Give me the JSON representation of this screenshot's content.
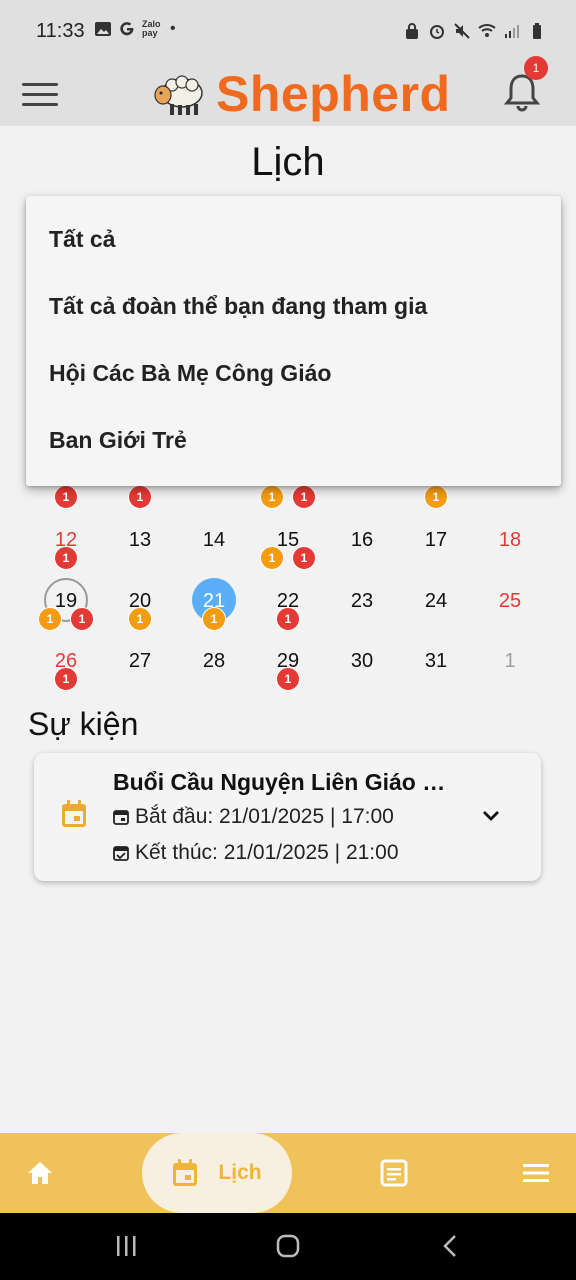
{
  "status_bar": {
    "time": "11:33",
    "zalo_label": "Zalo pay",
    "dot": "•"
  },
  "app_bar": {
    "brand": "Shepherd",
    "notification_count": "1"
  },
  "page_title": "Lịch",
  "filter_menu": {
    "items": [
      "Tất cả",
      "Tất cả đoàn thể bạn đang tham gia",
      "Hội Các Bà Mẹ Công Giáo",
      "Ban Giới Trẻ"
    ]
  },
  "calendar": {
    "partial_row_badges": [
      "1",
      "1",
      "1",
      "1",
      "1"
    ],
    "rows": [
      {
        "days": [
          "12",
          "13",
          "14",
          "15",
          "16",
          "17",
          "18"
        ]
      },
      {
        "days": [
          "19",
          "20",
          "21",
          "22",
          "23",
          "24",
          "25"
        ]
      },
      {
        "days": [
          "26",
          "27",
          "28",
          "29",
          "30",
          "31",
          "1"
        ]
      }
    ],
    "today": "19",
    "selected": "21",
    "badge_value": "1",
    "colors": {
      "red_badge": "#e53935",
      "orange_badge": "#f39c12",
      "selected": "#5aaef5",
      "weekend": "#e53935"
    }
  },
  "events": {
    "title": "Sự kiện",
    "items": [
      {
        "title": "Buổi Cầu Nguyện Liên Giáo Xứ",
        "start": "Bắt đầu: 21/01/2025 | 17:00",
        "end": "Kết thúc: 21/01/2025 | 21:00"
      }
    ]
  },
  "bottom_nav": {
    "active_label": "Lịch",
    "icons": [
      "home-icon",
      "calendar-icon",
      "article-icon",
      "menu-icon"
    ],
    "background": "#f0c25a",
    "accent": "#f0b43a"
  }
}
